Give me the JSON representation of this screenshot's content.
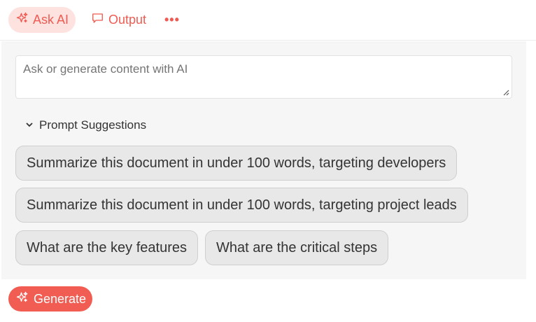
{
  "toolbar": {
    "tabs": [
      {
        "label": "Ask AI",
        "icon": "sparkle-icon",
        "active": true
      },
      {
        "label": "Output",
        "icon": "comment-icon",
        "active": false
      }
    ],
    "more": "•••"
  },
  "prompt": {
    "placeholder": "Ask or generate content with AI"
  },
  "suggestions": {
    "title": "Prompt Suggestions",
    "items": [
      "Summarize this document in under 100 words, targeting developers",
      "Summarize this document in under 100 words, targeting project leads",
      "What are the key features",
      "What are the critical steps"
    ]
  },
  "actions": {
    "generate": "Generate"
  },
  "colors": {
    "accent": "#f15d52",
    "accent_light": "#fde2e0",
    "panel_bg": "#f6f6f6",
    "chip_bg": "#e8e8e8"
  }
}
